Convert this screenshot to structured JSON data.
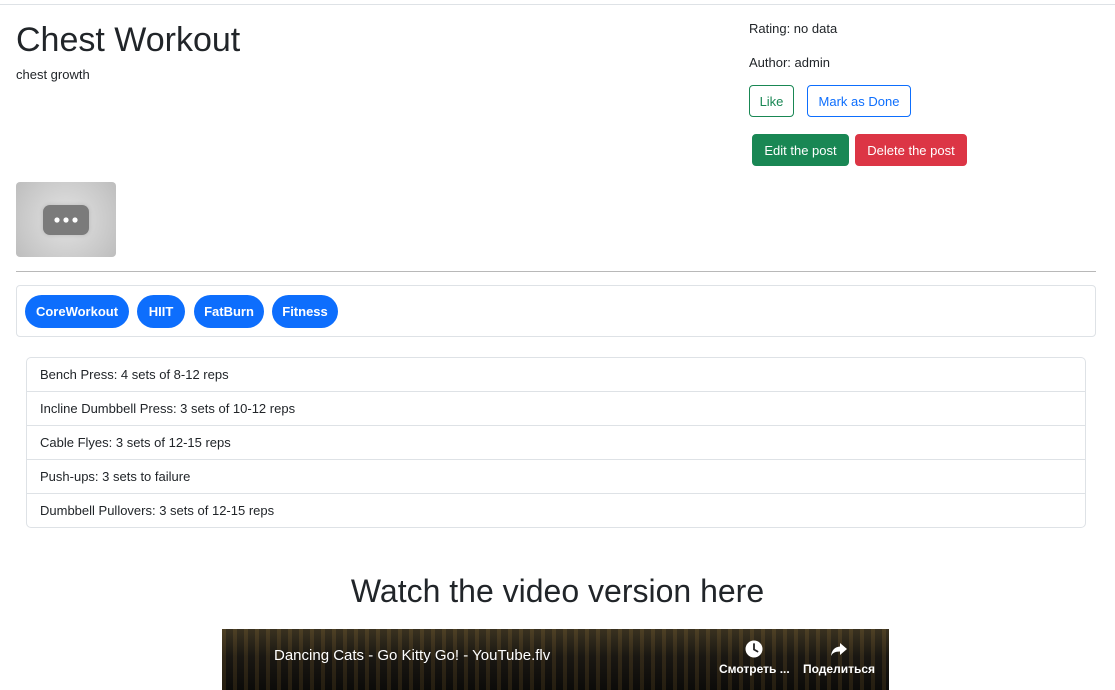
{
  "post": {
    "title": "Chest Workout",
    "description": "chest growth",
    "rating": "Rating: no data",
    "author": "Author: admin"
  },
  "actions": {
    "like": "Like",
    "mark_done": "Mark as Done",
    "edit": "Edit the post",
    "delete": "Delete the post"
  },
  "thumbnail": {
    "icon": "more-horizontal-icon"
  },
  "tags": [
    "CoreWorkout",
    "HIIT",
    "FatBurn",
    "Fitness"
  ],
  "exercises": [
    "Bench Press: 4 sets of 8-12 reps",
    "Incline Dumbbell Press: 3 sets of 10-12 reps",
    "Cable Flyes: 3 sets of 12-15 reps",
    "Push-ups: 3 sets to failure",
    "Dumbbell Pullovers: 3 sets of 12-15 reps"
  ],
  "video": {
    "heading": "Watch the video version here",
    "title": "Dancing Cats - Go Kitty Go! - YouTube.flv",
    "watch_later_label": "Смотреть ...",
    "share_label": "Поделиться"
  },
  "colors": {
    "success": "#198754",
    "primary": "#0d6efd",
    "danger": "#dc3545",
    "border": "#dee2e6"
  }
}
